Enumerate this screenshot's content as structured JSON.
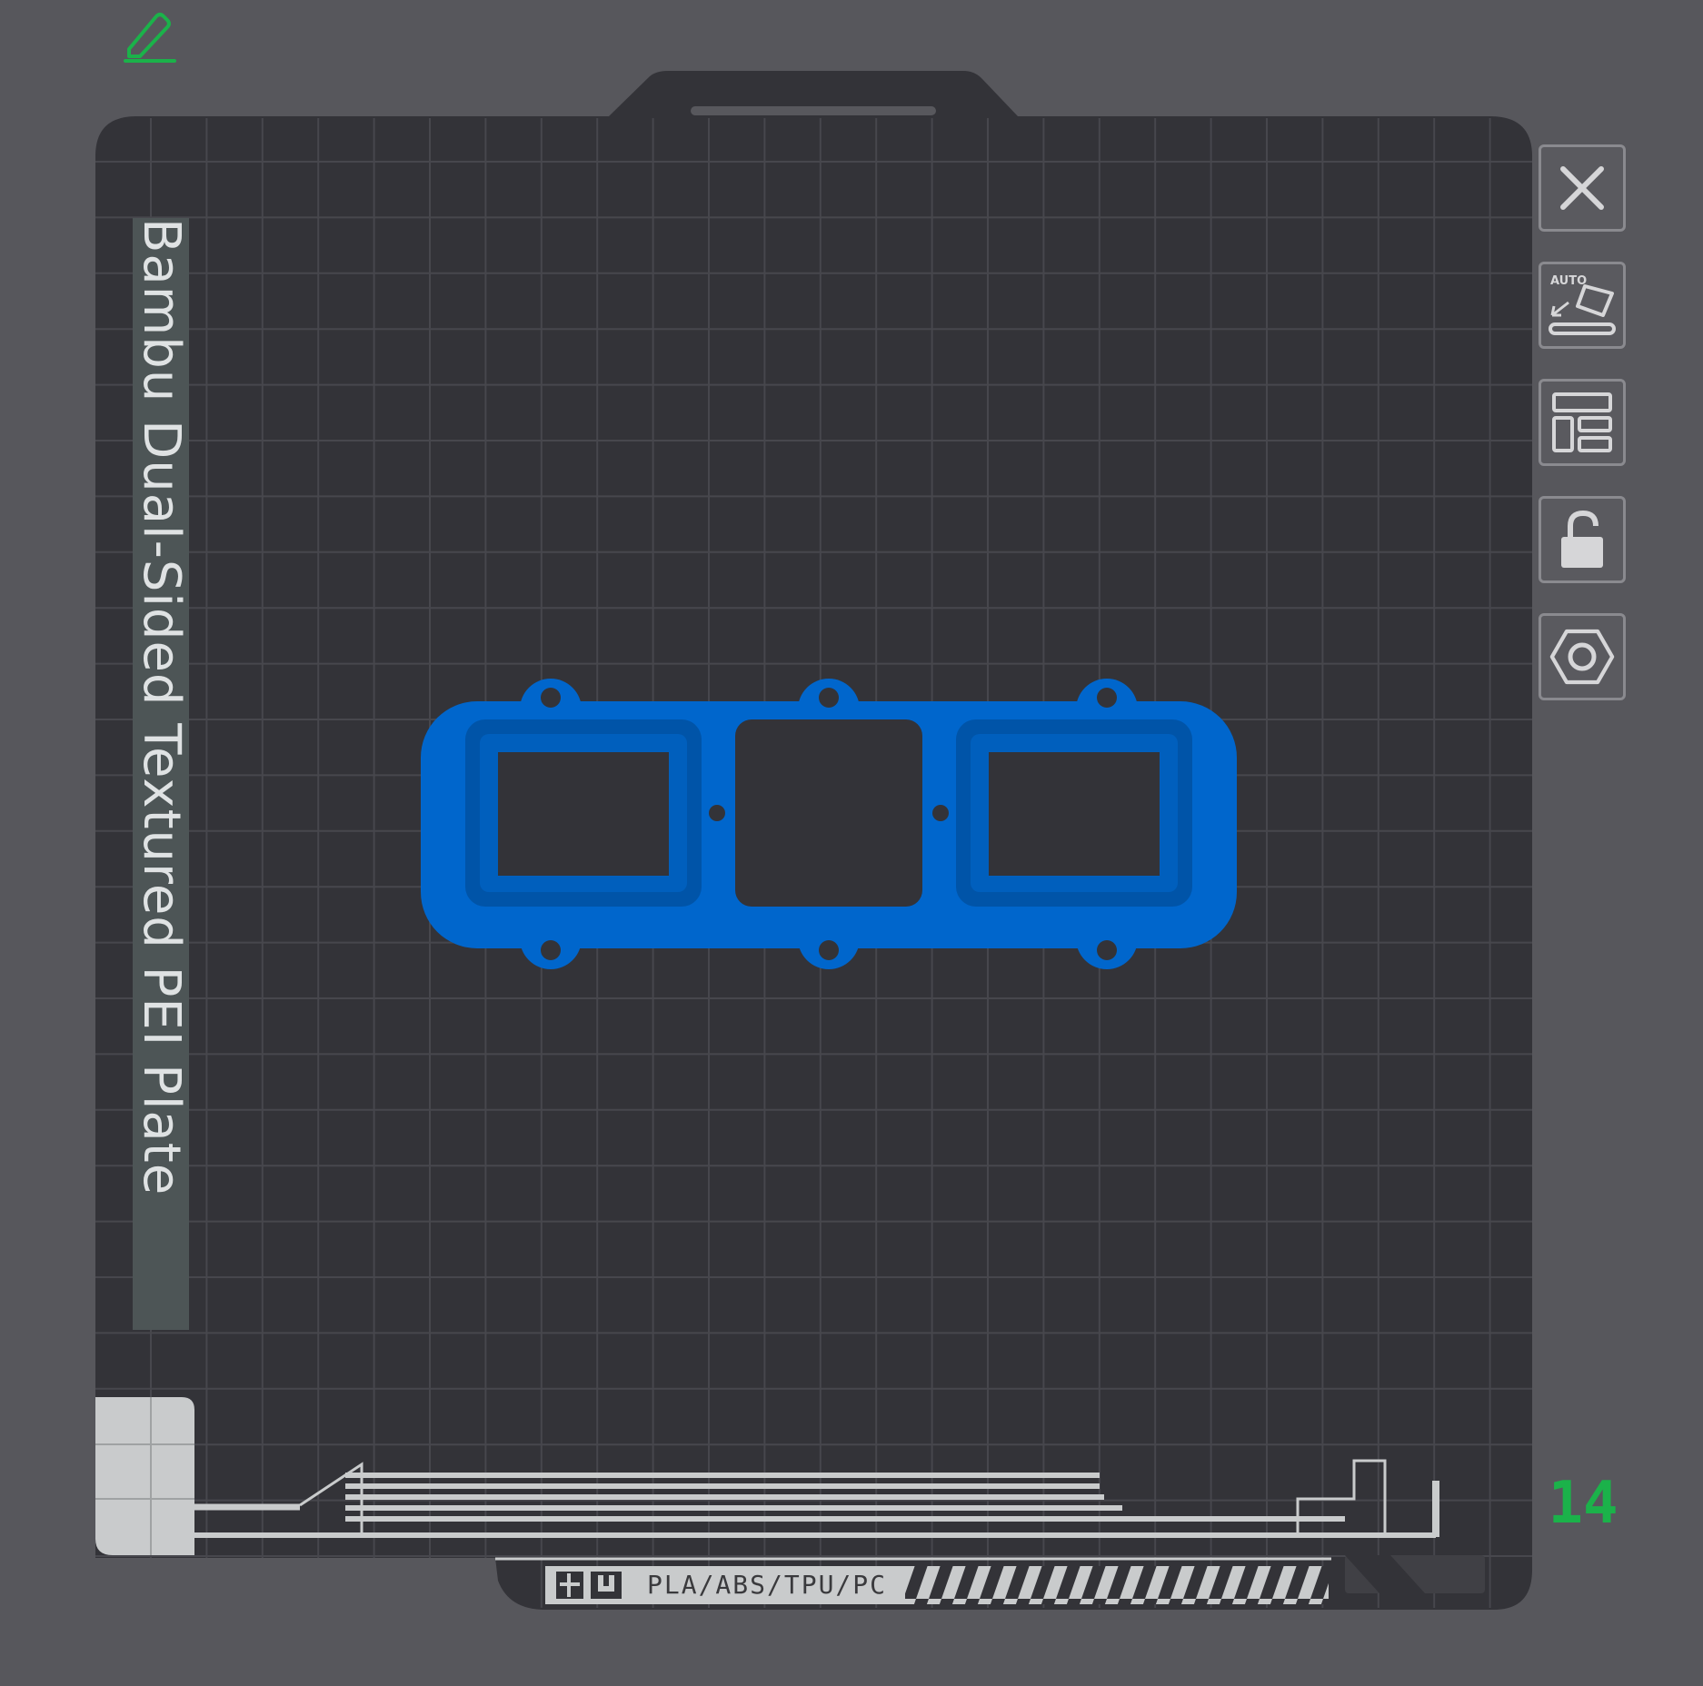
{
  "plate": {
    "name": "Bambu Dual-Sided Textured PEI Plate",
    "number": "14",
    "filament_label": "PLA/ABS/TPU/PC"
  },
  "toolbar": {
    "buttons": [
      {
        "name": "close-plate-button",
        "icon": "close-icon"
      },
      {
        "name": "auto-orient-button",
        "icon": "auto-orient-icon",
        "badge": "AUTO"
      },
      {
        "name": "arrange-button",
        "icon": "arrange-icon"
      },
      {
        "name": "lock-button",
        "icon": "unlock-icon"
      },
      {
        "name": "plate-settings-button",
        "icon": "hexagon-settings-icon"
      }
    ]
  },
  "edit": {
    "icon": "pencil-edit-icon"
  },
  "colors": {
    "background": "#57575c",
    "plate": "#333338",
    "grid": "#48484e",
    "part": "#0066cc",
    "accent": "#1bb24a"
  }
}
